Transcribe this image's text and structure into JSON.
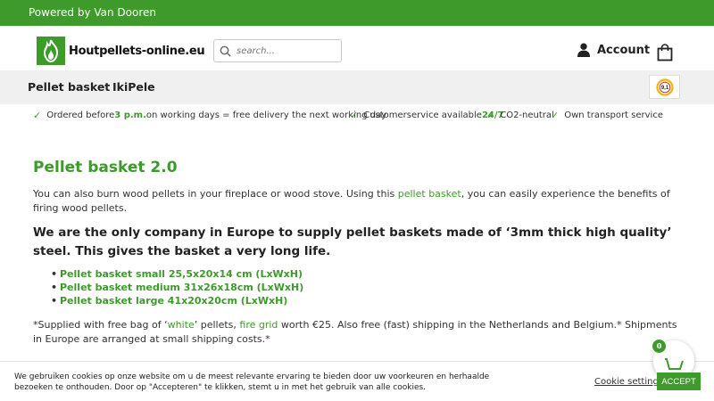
{
  "topbar": {
    "text": "Powered by Van Dooren"
  },
  "header": {
    "logo_text": "Houtpellets-online.eu",
    "search_placeholder": "search...",
    "account_label": "Account"
  },
  "nav": {
    "items": [
      {
        "label": "Pellet basket"
      },
      {
        "label": "IkiPele"
      }
    ]
  },
  "badge": {
    "score": "9,1"
  },
  "usps": [
    {
      "pre": "Ordered before ",
      "bold": "3 p.m.",
      "post": " on working days = free delivery the next working day"
    },
    {
      "pre": "Customerservice available ",
      "bold": "24/7",
      "post": ""
    },
    {
      "pre": "CO2-neutral",
      "bold": "",
      "post": ""
    },
    {
      "pre": "Own transport service",
      "bold": "",
      "post": ""
    }
  ],
  "content": {
    "title": "Pellet basket 2.0",
    "intro_pre": "You can also burn wood pellets in your fireplace or wood stove. Using this ",
    "intro_link": "pellet basket",
    "intro_post": ", you can easily experience the benefits of firing wood pellets.",
    "headline": "We are the only company in Europe to supply pellet baskets made of ‘3mm thick high quality’ steel. This gives the basket a very long life.",
    "products": [
      {
        "label": "Pellet basket small 25,5x20x14 cm (LxWxH)"
      },
      {
        "label": "Pellet basket medium 31x26x18cm (LxWxH)"
      },
      {
        "label": "Pellet basket large 41x20x20cm (LxWxH)"
      }
    ],
    "note_1": "*Supplied with free bag of ‘",
    "note_link1": "white",
    "note_2": "’ pellets, ",
    "note_link2": "fire grid",
    "note_3": " worth €25. Also free (fast) shipping in the Netherlands and Belgium.* Shipments in Europe are arranged at small shipping costs.*"
  },
  "cookie": {
    "text": "We gebruiken cookies op onze website om u de meest relevante ervaring te bieden door uw voorkeuren en herhaalde bezoeken te onthouden. Door op \"Accepteren\" te klikken, stemt u in met het gebruik van alle cookies.",
    "settings_label": "Cookie settings",
    "accept_label": "ACCEPT"
  },
  "floating_cart": {
    "count": "0"
  },
  "colors": {
    "brand_green": "#3d9a2b",
    "nav_bg": "#f0f0f0"
  }
}
